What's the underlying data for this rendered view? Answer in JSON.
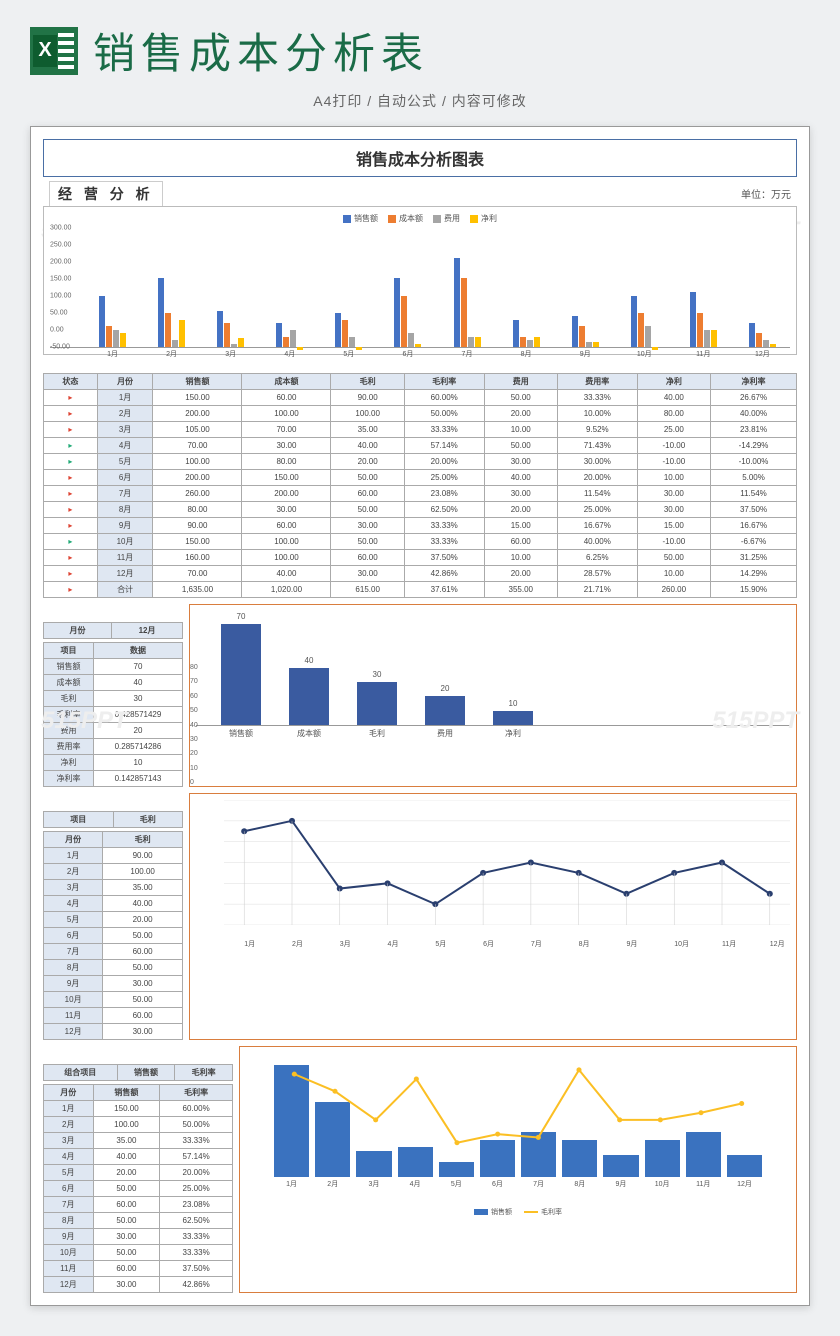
{
  "header": {
    "title": "销售成本分析表",
    "sub": "A4打印 / 自动公式 / 内容可修改"
  },
  "doc": {
    "title": "销售成本分析图表",
    "section": "经 营 分 析",
    "unit": "单位：万元"
  },
  "watermark": "515PPT",
  "chart_data": [
    {
      "type": "bar",
      "title": "经营分析",
      "ylim": [
        -50,
        300
      ],
      "categories": [
        "1月",
        "2月",
        "3月",
        "4月",
        "5月",
        "6月",
        "7月",
        "8月",
        "9月",
        "10月",
        "11月",
        "12月"
      ],
      "series": [
        {
          "name": "销售额",
          "values": [
            150,
            200,
            105,
            70,
            100,
            200,
            260,
            80,
            90,
            150,
            160,
            70
          ],
          "color": "#4472c4"
        },
        {
          "name": "成本额",
          "values": [
            60,
            100,
            70,
            30,
            80,
            150,
            200,
            30,
            60,
            100,
            100,
            40
          ],
          "color": "#ed7d31"
        },
        {
          "name": "费用",
          "values": [
            50,
            20,
            10,
            50,
            30,
            40,
            30,
            20,
            15,
            60,
            50,
            20
          ],
          "color": "#a5a5a5"
        },
        {
          "name": "净利",
          "values": [
            40,
            80,
            25,
            -10,
            -10,
            10,
            30,
            30,
            15,
            -10,
            50,
            10
          ],
          "color": "#ffc000"
        }
      ]
    },
    {
      "type": "bar",
      "title": "12月",
      "categories": [
        "销售额",
        "成本额",
        "毛利",
        "费用",
        "净利"
      ],
      "values": [
        70,
        40,
        30,
        20,
        10
      ],
      "ylim": [
        0,
        80
      ]
    },
    {
      "type": "line",
      "title": "毛利",
      "x": [
        "1月",
        "2月",
        "3月",
        "4月",
        "5月",
        "6月",
        "7月",
        "8月",
        "9月",
        "10月",
        "11月",
        "12月"
      ],
      "values": [
        90,
        100,
        35,
        40,
        20,
        50,
        60,
        50,
        30,
        50,
        60,
        30
      ],
      "ylim": [
        0,
        120
      ]
    },
    {
      "type": "bar",
      "title": "组合",
      "x": [
        "1月",
        "2月",
        "3月",
        "4月",
        "5月",
        "6月",
        "7月",
        "8月",
        "9月",
        "10月",
        "11月",
        "12月"
      ],
      "series": [
        {
          "name": "销售额",
          "values": [
            150,
            100,
            35,
            40,
            20,
            50,
            60,
            50,
            30,
            50,
            60,
            30
          ],
          "axis": "left"
        },
        {
          "name": "毛利率",
          "values": [
            60,
            50,
            33.33,
            57.14,
            20,
            25,
            23.08,
            62.5,
            33.33,
            33.33,
            37.5,
            42.86
          ],
          "axis": "right"
        }
      ],
      "ylim_left": [
        0,
        160
      ],
      "ylim_right": [
        0,
        70
      ]
    }
  ],
  "table": {
    "headers": [
      "状态",
      "月份",
      "销售额",
      "成本额",
      "毛利",
      "毛利率",
      "费用",
      "费用率",
      "净利",
      "净利率"
    ],
    "rows": [
      [
        "r",
        "1月",
        "150.00",
        "60.00",
        "90.00",
        "60.00%",
        "50.00",
        "33.33%",
        "40.00",
        "26.67%"
      ],
      [
        "r",
        "2月",
        "200.00",
        "100.00",
        "100.00",
        "50.00%",
        "20.00",
        "10.00%",
        "80.00",
        "40.00%"
      ],
      [
        "r",
        "3月",
        "105.00",
        "70.00",
        "35.00",
        "33.33%",
        "10.00",
        "9.52%",
        "25.00",
        "23.81%"
      ],
      [
        "g",
        "4月",
        "70.00",
        "30.00",
        "40.00",
        "57.14%",
        "50.00",
        "71.43%",
        "-10.00",
        "-14.29%"
      ],
      [
        "g",
        "5月",
        "100.00",
        "80.00",
        "20.00",
        "20.00%",
        "30.00",
        "30.00%",
        "-10.00",
        "-10.00%"
      ],
      [
        "r",
        "6月",
        "200.00",
        "150.00",
        "50.00",
        "25.00%",
        "40.00",
        "20.00%",
        "10.00",
        "5.00%"
      ],
      [
        "r",
        "7月",
        "260.00",
        "200.00",
        "60.00",
        "23.08%",
        "30.00",
        "11.54%",
        "30.00",
        "11.54%"
      ],
      [
        "r",
        "8月",
        "80.00",
        "30.00",
        "50.00",
        "62.50%",
        "20.00",
        "25.00%",
        "30.00",
        "37.50%"
      ],
      [
        "r",
        "9月",
        "90.00",
        "60.00",
        "30.00",
        "33.33%",
        "15.00",
        "16.67%",
        "15.00",
        "16.67%"
      ],
      [
        "g",
        "10月",
        "150.00",
        "100.00",
        "50.00",
        "33.33%",
        "60.00",
        "40.00%",
        "-10.00",
        "-6.67%"
      ],
      [
        "r",
        "11月",
        "160.00",
        "100.00",
        "60.00",
        "37.50%",
        "10.00",
        "6.25%",
        "50.00",
        "31.25%"
      ],
      [
        "r",
        "12月",
        "70.00",
        "40.00",
        "30.00",
        "42.86%",
        "20.00",
        "28.57%",
        "10.00",
        "14.29%"
      ],
      [
        "r",
        "合计",
        "1,635.00",
        "1,020.00",
        "615.00",
        "37.61%",
        "355.00",
        "21.71%",
        "260.00",
        "15.90%"
      ]
    ]
  },
  "detail": {
    "month_label": "月份",
    "month": "12月",
    "item_label": "项目",
    "data_label": "数据",
    "rows": [
      [
        "销售额",
        "70"
      ],
      [
        "成本额",
        "40"
      ],
      [
        "毛利",
        "30"
      ],
      [
        "毛利率",
        "0.428571429"
      ],
      [
        "费用",
        "20"
      ],
      [
        "费用率",
        "0.285714286"
      ],
      [
        "净利",
        "10"
      ],
      [
        "净利率",
        "0.142857143"
      ]
    ]
  },
  "maoli": {
    "item_label": "项目",
    "value_label": "毛利",
    "month_label": "月份",
    "rows": [
      [
        "1月",
        "90.00"
      ],
      [
        "2月",
        "100.00"
      ],
      [
        "3月",
        "35.00"
      ],
      [
        "4月",
        "40.00"
      ],
      [
        "5月",
        "20.00"
      ],
      [
        "6月",
        "50.00"
      ],
      [
        "7月",
        "60.00"
      ],
      [
        "8月",
        "50.00"
      ],
      [
        "9月",
        "30.00"
      ],
      [
        "10月",
        "50.00"
      ],
      [
        "11月",
        "60.00"
      ],
      [
        "12月",
        "30.00"
      ]
    ]
  },
  "combo": {
    "header": "组合项目",
    "c1": "销售额",
    "c2": "毛利率",
    "month_label": "月份",
    "rows": [
      [
        "1月",
        "150.00",
        "60.00%"
      ],
      [
        "2月",
        "100.00",
        "50.00%"
      ],
      [
        "3月",
        "35.00",
        "33.33%"
      ],
      [
        "4月",
        "40.00",
        "57.14%"
      ],
      [
        "5月",
        "20.00",
        "20.00%"
      ],
      [
        "6月",
        "50.00",
        "25.00%"
      ],
      [
        "7月",
        "60.00",
        "23.08%"
      ],
      [
        "8月",
        "50.00",
        "62.50%"
      ],
      [
        "9月",
        "30.00",
        "33.33%"
      ],
      [
        "10月",
        "50.00",
        "33.33%"
      ],
      [
        "11月",
        "60.00",
        "37.50%"
      ],
      [
        "12月",
        "30.00",
        "42.86%"
      ]
    ]
  }
}
